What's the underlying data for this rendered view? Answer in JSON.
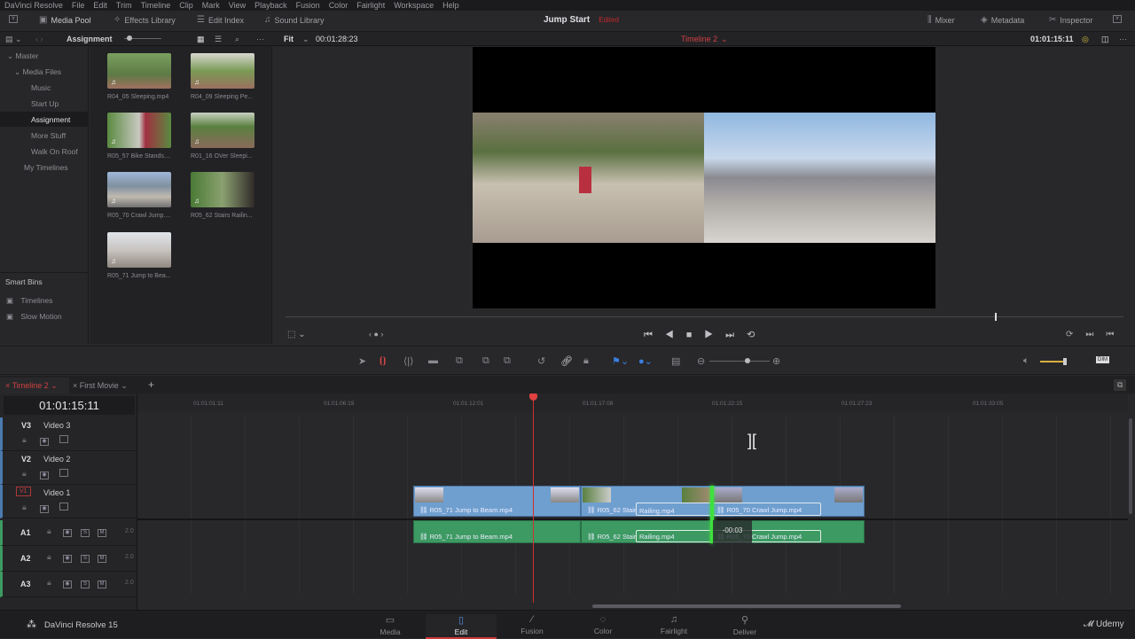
{
  "menu": [
    "DaVinci Resolve",
    "File",
    "Edit",
    "Trim",
    "Timeline",
    "Clip",
    "Mark",
    "View",
    "Playback",
    "Fusion",
    "Color",
    "Fairlight",
    "Workspace",
    "Help"
  ],
  "toolbar": {
    "media_pool": "Media Pool",
    "effects_library": "Effects Library",
    "edit_index": "Edit Index",
    "sound_library": "Sound Library",
    "project_title": "Jump Start",
    "project_status": "Edited",
    "mixer": "Mixer",
    "metadata": "Metadata",
    "inspector": "Inspector"
  },
  "subbar": {
    "bin_name": "Assignment",
    "zoom": "Fit",
    "source_duration": "00:01:28:23",
    "timeline_name": "Timeline 2",
    "timecode": "01:01:15:11"
  },
  "bins": {
    "master": "Master",
    "media_files": "Media Files",
    "items": [
      "Music",
      "Start Up",
      "Assignment",
      "More Stuff",
      "Walk On Roof"
    ],
    "my_timelines": "My Timelines",
    "smart_bins": "Smart Bins",
    "smart_items": [
      "Timelines",
      "Slow Motion"
    ]
  },
  "clips": [
    "R04_05 Sleeping.mp4",
    "R04_09 Sleeping Pe...",
    "R05_57 Bike Stands....",
    "R01_16 OVer Sleepi...",
    "R05_70 Crawl Jump....",
    "R05_62 Stairs Railin...",
    "R05_71 Jump to Bea..."
  ],
  "timeline": {
    "tabs": [
      "Timeline 2",
      "First Movie"
    ],
    "timecode": "01:01:15:11",
    "ruler": [
      "01:01:01:11",
      "01:01:06:19",
      "01:01:12:01",
      "01:01:17:08",
      "01:01:22:15",
      "01:01:27:23",
      "01:01:33:05"
    ],
    "video_tracks": [
      {
        "id": "V3",
        "name": "Video 3"
      },
      {
        "id": "V2",
        "name": "Video 2"
      },
      {
        "id": "V1",
        "name": "Video 1"
      }
    ],
    "audio_tracks": [
      {
        "id": "A1",
        "level": "2.0"
      },
      {
        "id": "A2",
        "level": "2.0"
      },
      {
        "id": "A3",
        "level": "2.0"
      }
    ],
    "solo": "S",
    "mute": "M",
    "clip_names": [
      "R05_71 Jump to Beam.mp4",
      "R05_62 Stair",
      "Railing.mp4",
      "R05_70 Crawl Jump.mp4"
    ],
    "trim_offset": "-00:03",
    "dim": "DIM"
  },
  "pages": [
    "Media",
    "Edit",
    "Fusion",
    "Color",
    "Fairlight",
    "Deliver"
  ],
  "active_page": "Edit",
  "brand": "DaVinci Resolve 15",
  "watermark": "Udemy",
  "colors": {
    "accent": "#e64b4b",
    "video_clip": "#6f9fcf",
    "audio_clip": "#3c9a62"
  }
}
